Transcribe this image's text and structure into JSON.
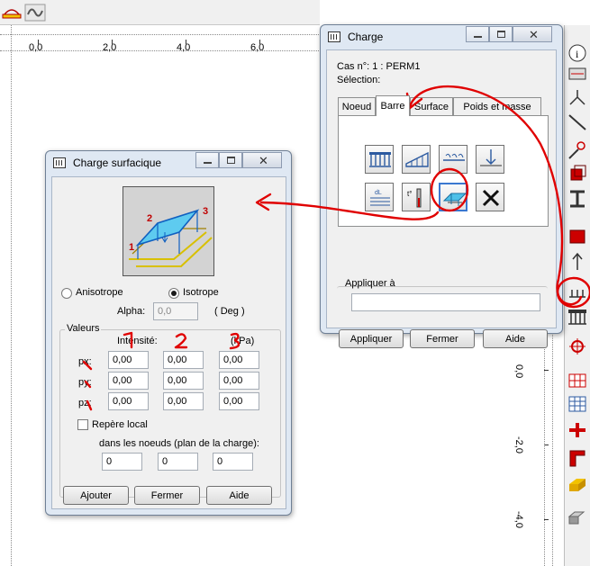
{
  "ruler": {
    "x_labels": [
      "0,0",
      "2,0",
      "4,0",
      "6,0"
    ],
    "y_labels": [
      "0,0",
      "-2,0",
      "-4,0"
    ]
  },
  "charge_window": {
    "title": "Charge",
    "case_text": "Cas n°: 1 : PERM1",
    "selection_label": "Sélection:",
    "tabs": [
      "Noeud",
      "Barre",
      "Surface",
      "Poids et masse"
    ],
    "active_tab": "Barre",
    "apply_label": "Appliquer à",
    "apply_value": "",
    "buttons": {
      "apply": "Appliquer",
      "close": "Fermer",
      "help": "Aide"
    },
    "load_types": [
      "uniform-load-icon",
      "trapezoidal-load-icon",
      "moment-load-icon",
      "point-load-icon",
      "dilatation-load-icon",
      "thermal-load-icon",
      "surface-load-icon",
      "delete-load-icon"
    ],
    "selected_load_type": "surface-load-icon"
  },
  "surface_window": {
    "title": "Charge surfacique",
    "preview_labels": [
      "1",
      "2",
      "3"
    ],
    "anisotrope_label": "Anisotrope",
    "isotrope_label": "Isotrope",
    "isotrope_selected": true,
    "alpha_label": "Alpha:",
    "alpha_value": "0,0",
    "alpha_unit": "( Deg )",
    "values_group": "Valeurs",
    "intensity_label": "Intensité:",
    "unit_label": "(kPa)",
    "rows": [
      {
        "label": "px:",
        "values": [
          "0,00",
          "0,00",
          "0,00"
        ]
      },
      {
        "label": "py:",
        "values": [
          "0,00",
          "0,00",
          "0,00"
        ]
      },
      {
        "label": "pz:",
        "values": [
          "0,00",
          "0,00",
          "0,00"
        ]
      }
    ],
    "local_label": "Repère local",
    "local_checked": false,
    "nodes_label": "dans les noeuds (plan de la charge):",
    "nodes": [
      "0",
      "0",
      "0"
    ],
    "buttons": {
      "add": "Ajouter",
      "close": "Fermer",
      "help": "Aide"
    }
  },
  "annotations": {
    "column_numbers": [
      "1",
      "2",
      "3"
    ],
    "color": "#e00000"
  }
}
